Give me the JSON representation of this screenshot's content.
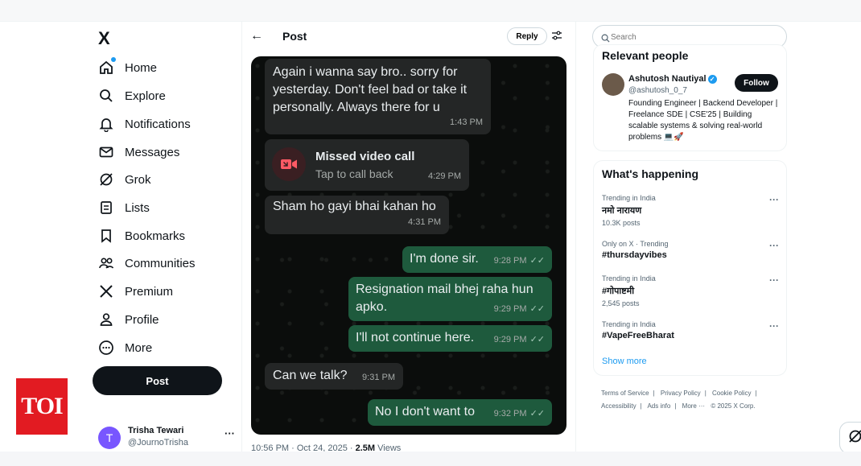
{
  "sidebar": {
    "logo": "X",
    "items": [
      {
        "label": "Home",
        "icon": "home-icon"
      },
      {
        "label": "Explore",
        "icon": "search-icon"
      },
      {
        "label": "Notifications",
        "icon": "bell-icon"
      },
      {
        "label": "Messages",
        "icon": "envelope-icon"
      },
      {
        "label": "Grok",
        "icon": "grok-icon"
      },
      {
        "label": "Lists",
        "icon": "list-icon"
      },
      {
        "label": "Bookmarks",
        "icon": "bookmark-icon"
      },
      {
        "label": "Communities",
        "icon": "people-icon"
      },
      {
        "label": "Premium",
        "icon": "x-icon"
      },
      {
        "label": "Profile",
        "icon": "person-icon"
      },
      {
        "label": "More",
        "icon": "more-circle-icon"
      }
    ],
    "post_label": "Post",
    "account": {
      "initial": "T",
      "name": "Trisha Tewari",
      "handle": "@JournoTrisha",
      "more": "···"
    }
  },
  "badge": {
    "text": "TOI"
  },
  "header": {
    "back": "←",
    "title": "Post",
    "reply_label": "Reply"
  },
  "chat": {
    "messages": [
      {
        "text": "Again i wanna say bro.. sorry for yesterday. Don't feel bad or take it personally. Always there for u",
        "time": "1:43 PM"
      },
      {
        "title": "Missed video call",
        "subtitle": "Tap to call back",
        "time": "4:29 PM"
      },
      {
        "text": "Sham ho gayi bhai kahan ho",
        "time": "4:31 PM"
      },
      {
        "text": "I'm done sir.",
        "time": "9:28 PM"
      },
      {
        "text": "Resignation mail bhej raha hun apko.",
        "time": "9:29 PM"
      },
      {
        "text": "I'll not continue here.",
        "time": "9:29 PM"
      },
      {
        "text": "Can we talk?",
        "time": "9:31 PM"
      },
      {
        "text": "No I don't want to",
        "time": "9:32 PM"
      }
    ],
    "ticks": "✓✓"
  },
  "post_meta": {
    "time": "10:56 PM · Oct 24, 2025 · ",
    "views_count": "2.5M",
    "views_label": " Views"
  },
  "search": {
    "placeholder": "Search"
  },
  "relevant": {
    "title": "Relevant people",
    "name": "Ashutosh Nautiyal",
    "handle": "@ashutosh_0_7",
    "follow_label": "Follow",
    "bio": "Founding Engineer | Backend Developer | Freelance SDE | CSE'25 | Building scalable systems & solving real-world problems 💻🚀"
  },
  "happening": {
    "title": "What's happening",
    "trends": [
      {
        "context": "Trending in India",
        "name": "नमो नारायण",
        "count": "10.3K posts"
      },
      {
        "context": "Only on X · Trending",
        "name": "#thursdayvibes",
        "count": ""
      },
      {
        "context": "Trending in India",
        "name": "#गोपाष्टमी",
        "count": "2,545 posts"
      },
      {
        "context": "Trending in India",
        "name": "#VapeFreeBharat",
        "count": ""
      }
    ],
    "more": "···",
    "show_more": "Show more"
  },
  "footer": {
    "links": [
      "Terms of Service",
      "|",
      "Privacy Policy",
      "|",
      "Cookie Policy",
      "|",
      "Accessibility",
      "|",
      "Ads info",
      "|",
      "More ···",
      "© 2025 X Corp."
    ]
  }
}
